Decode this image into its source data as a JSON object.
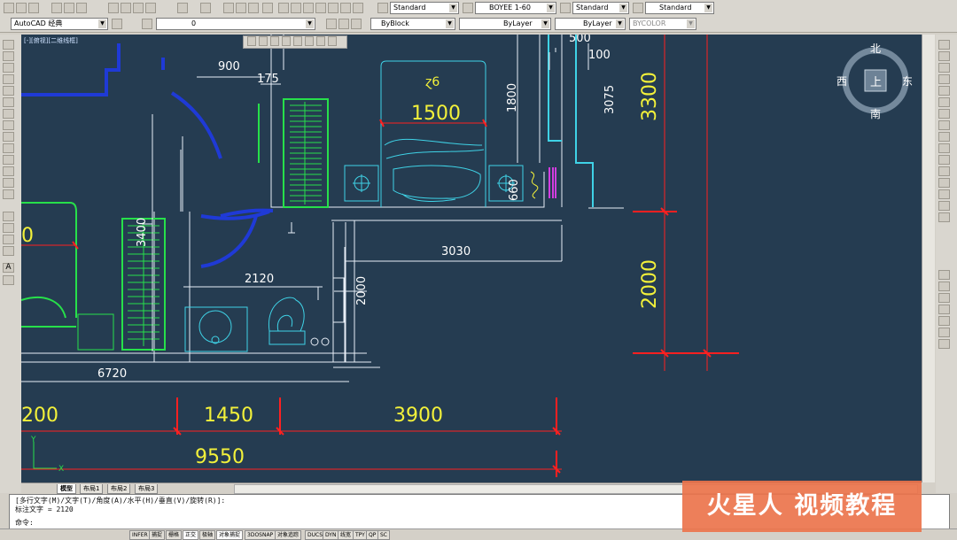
{
  "toolbar_top": {
    "text_style": "Standard",
    "dim_style": "BOYEE 1-60",
    "table_style": "Standard",
    "multileader_style": "Standard"
  },
  "toolbar_second": {
    "workspace": "AutoCAD 经典",
    "layer": "0",
    "color": "ByBlock",
    "linetype": "ByLayer",
    "lineweight": "ByLayer",
    "plotstyle": "BYCOLOR"
  },
  "viewport_label": "[-][俯视][二维线框]",
  "viewcube": {
    "north": "北",
    "south": "南",
    "west": "西",
    "east": "东",
    "face": "上"
  },
  "dimensions_cyan": {
    "d900": "900",
    "d175": "175",
    "d1500": "1500",
    "d1800": "1800",
    "d3075": "3075",
    "d500": "500",
    "d100": "100",
    "d660": "660",
    "d3400": "3400",
    "d3030": "3030",
    "d2120": "2120",
    "d2000": "2000",
    "d6720": "6720",
    "d0": "0"
  },
  "dimensions_yellow": {
    "d3300": "3300",
    "d2000": "2000",
    "d200": "200",
    "d1450": "1450",
    "d3900": "3900",
    "d9550": "9550"
  },
  "ucs": {
    "x": "X",
    "y": "Y"
  },
  "layout_tabs": [
    "模型",
    "布局1",
    "布局2",
    "布局3"
  ],
  "command_history": [
    "[多行文字(M)/文字(T)/角度(A)/水平(H)/垂直(V)/旋转(R)]:",
    "标注文字 = 2120"
  ],
  "command_prompt": "命令:",
  "status_buttons": [
    "INFER",
    "捕捉",
    "栅格",
    "正交",
    "极轴",
    "对象捕捉",
    "3DOSNAP",
    "对象追踪",
    "DUCS",
    "DYN",
    "线宽",
    "TPY",
    "QP",
    "SC"
  ],
  "watermark": "火星人 视频教程",
  "colors": {
    "canvas": "#253c51",
    "dim_yellow": "#f3f13a",
    "dim_cyan": "#ffffff",
    "wall_blue": "#1f3ad6",
    "furniture_cyan": "#3fd2e6",
    "cabinet_green": "#27e04a",
    "arrow_red": "#ff2020",
    "accent_orange": "#ec744c"
  }
}
